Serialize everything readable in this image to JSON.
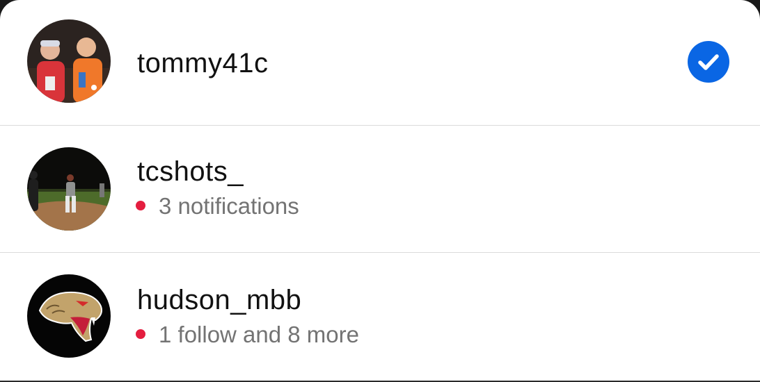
{
  "accounts": [
    {
      "username": "tommy41c",
      "avatar_icon": "photo-two-kids",
      "selected": true,
      "status_icon": "checkmark-icon"
    },
    {
      "username": "tcshots_",
      "avatar_icon": "photo-baseball-field",
      "notification_text": "3 notifications"
    },
    {
      "username": "hudson_mbb",
      "avatar_icon": "cobra-logo",
      "notification_text": "1 follow and 8 more"
    }
  ],
  "colors": {
    "check_blue": "#0a66e4",
    "notification_dot": "#e41e3f",
    "secondary_text": "#737373",
    "divider": "#dbdbdb"
  }
}
